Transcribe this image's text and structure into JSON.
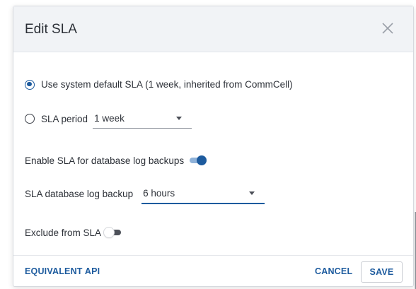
{
  "dialog": {
    "title": "Edit SLA",
    "close_icon": "close-icon"
  },
  "options": {
    "system_default": {
      "label": "Use system default SLA (1 week, inherited from CommCell)",
      "checked": true
    },
    "sla_period": {
      "label": "SLA period",
      "checked": false,
      "value": "1 week"
    }
  },
  "db_log": {
    "enable_label": "Enable SLA for database log backups",
    "enabled": true,
    "backup_label": "SLA database log backup",
    "backup_value": "6 hours"
  },
  "exclude": {
    "label": "Exclude from SLA",
    "enabled": false
  },
  "footer": {
    "equivalent_api": "EQUIVALENT API",
    "cancel": "CANCEL",
    "save": "SAVE"
  },
  "colors": {
    "accent": "#1d5b9e",
    "header_bg": "#f1f3f6",
    "backdrop": "#1f2a3a"
  }
}
